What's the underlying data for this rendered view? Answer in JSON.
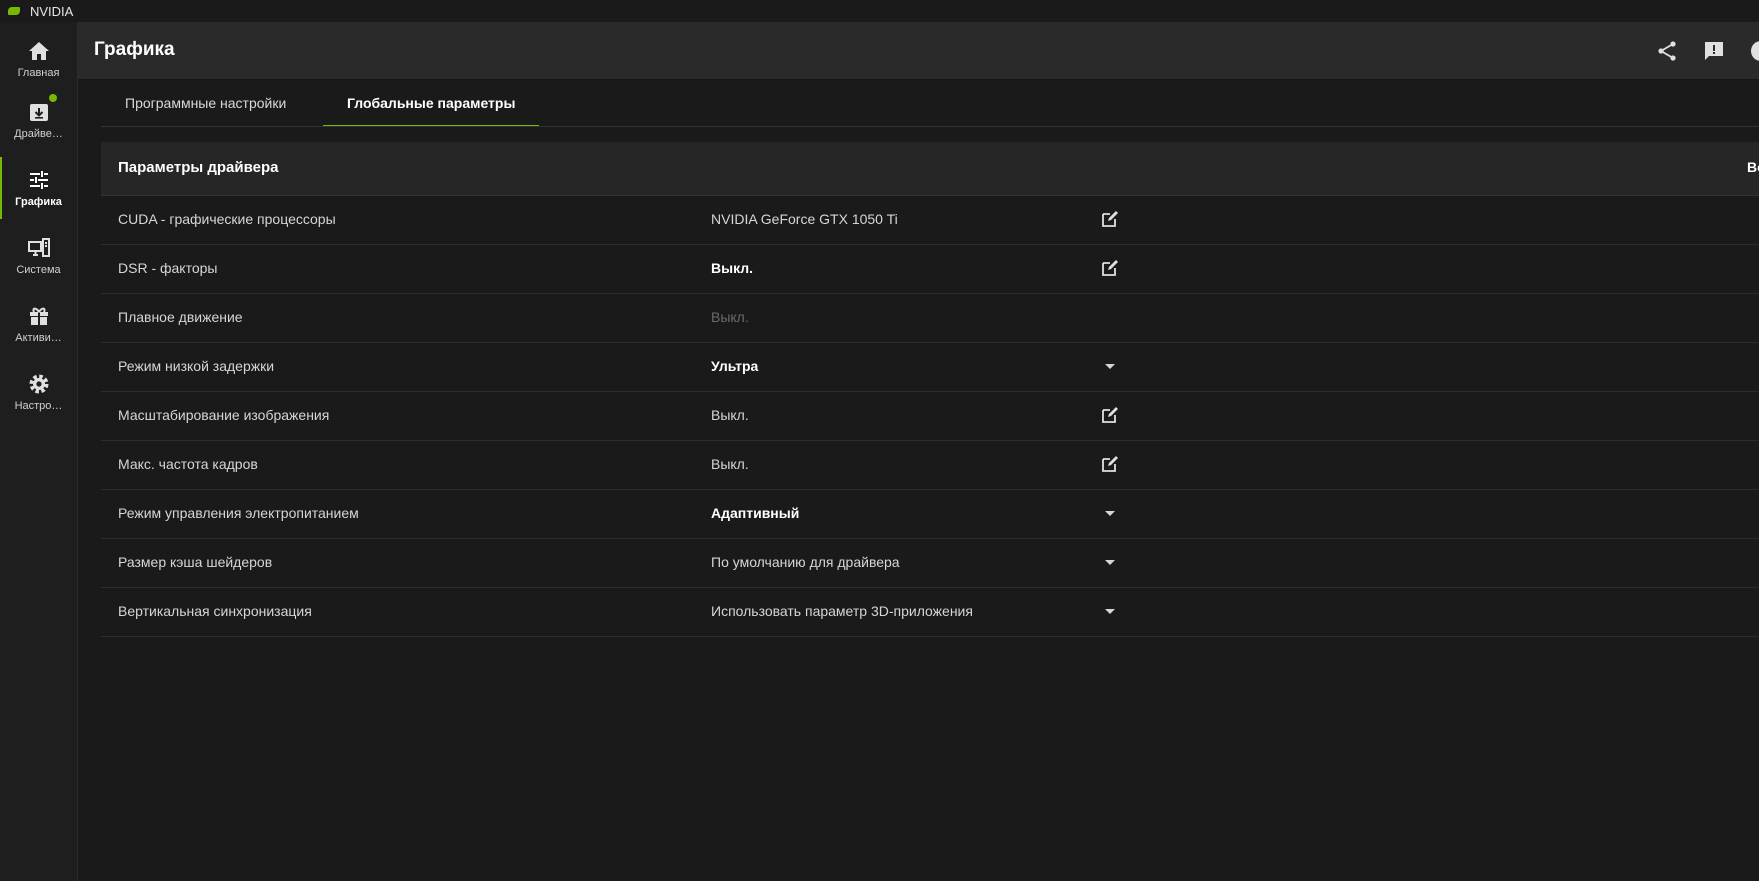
{
  "app": {
    "title": "NVIDIA"
  },
  "sidebar": {
    "items": [
      {
        "label": "Главная",
        "icon": "home-icon"
      },
      {
        "label": "Драйве…",
        "icon": "download-icon",
        "badge": true
      },
      {
        "label": "Графика",
        "icon": "sliders-icon",
        "active": true
      },
      {
        "label": "Система",
        "icon": "system-icon"
      },
      {
        "label": "Активи…",
        "icon": "gift-icon"
      },
      {
        "label": "Настро…",
        "icon": "gear-icon"
      }
    ]
  },
  "header": {
    "title": "Графика",
    "icons": [
      "share-icon",
      "feedback-icon",
      "profile-icon"
    ]
  },
  "tabs": [
    {
      "label": "Программные настройки",
      "active": false
    },
    {
      "label": "Глобальные параметры",
      "active": true
    }
  ],
  "panel": {
    "title": "Параметры драйвера",
    "right_text": "Во",
    "rows": [
      {
        "label": "CUDA - графические процессоры",
        "value": "NVIDIA GeForce GTX 1050 Ti",
        "style": "normal",
        "control": "edit"
      },
      {
        "label": "DSR - факторы",
        "value": "Выкл.",
        "style": "bold",
        "control": "edit"
      },
      {
        "label": "Плавное движение",
        "value": "Выкл.",
        "style": "dim",
        "control": "none"
      },
      {
        "label": "Режим низкой задержки",
        "value": "Ультра",
        "style": "bold",
        "control": "dropdown"
      },
      {
        "label": "Масштабирование изображения",
        "value": "Выкл.",
        "style": "normal",
        "control": "edit"
      },
      {
        "label": "Макс. частота кадров",
        "value": "Выкл.",
        "style": "normal",
        "control": "edit"
      },
      {
        "label": "Режим управления электропитанием",
        "value": "Адаптивный",
        "style": "bold",
        "control": "dropdown"
      },
      {
        "label": "Размер кэша шейдеров",
        "value": "По умолчанию для драйвера",
        "style": "normal",
        "control": "dropdown"
      },
      {
        "label": "Вертикальная синхронизация",
        "value": "Использовать параметр 3D-приложения",
        "style": "normal",
        "control": "dropdown"
      }
    ]
  },
  "colors": {
    "accent": "#76b900",
    "background": "#1a1a1a",
    "header": "#2a2a2a",
    "panel_header": "#262626"
  }
}
